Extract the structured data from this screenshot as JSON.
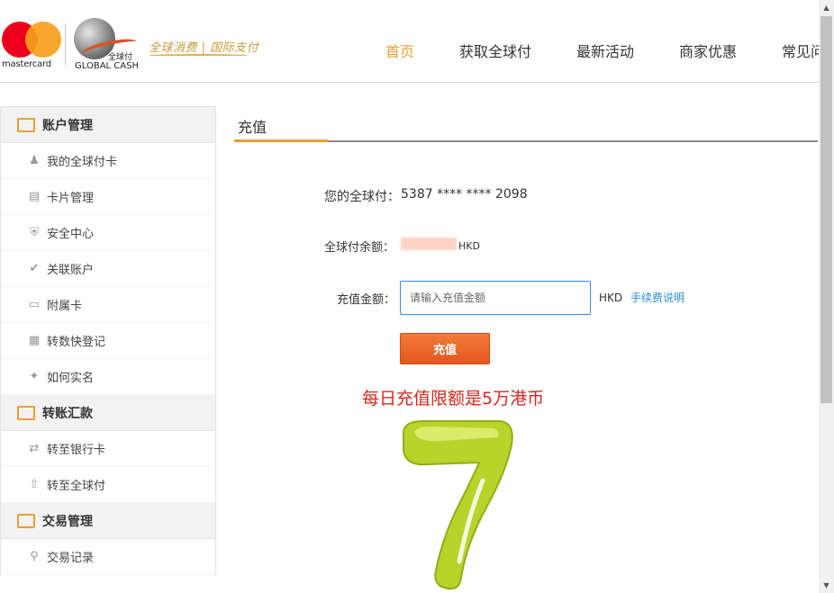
{
  "header": {
    "mastercard_text": "mastercard",
    "globalcash_cn": "全球付",
    "globalcash_en": "GLOBAL CASH",
    "slogan": "全球消费 | 国际支付",
    "nav": [
      {
        "label": "首页",
        "active": true
      },
      {
        "label": "获取全球付",
        "active": false
      },
      {
        "label": "最新活动",
        "active": false
      },
      {
        "label": "商家优惠",
        "active": false
      },
      {
        "label": "常见问",
        "active": false
      }
    ]
  },
  "sidebar": {
    "groups": [
      {
        "label": "账户管理",
        "items": [
          {
            "label": "我的全球付卡",
            "icon": "user-icon"
          },
          {
            "label": "卡片管理",
            "icon": "card-icon"
          },
          {
            "label": "安全中心",
            "icon": "shield-icon"
          },
          {
            "label": "关联账户",
            "icon": "check-circle-icon"
          },
          {
            "label": "附属卡",
            "icon": "card-outline-icon"
          },
          {
            "label": "转数快登记",
            "icon": "document-icon"
          },
          {
            "label": "如何实名",
            "icon": "badge-icon"
          }
        ]
      },
      {
        "label": "转账汇款",
        "items": [
          {
            "label": "转至银行卡",
            "icon": "exchange-icon"
          },
          {
            "label": "转至全球付",
            "icon": "upload-icon"
          }
        ]
      },
      {
        "label": "交易管理",
        "items": [
          {
            "label": "交易记录",
            "icon": "search-icon"
          }
        ]
      }
    ]
  },
  "main": {
    "tab_title": "充值",
    "card_label": "您的全球付：",
    "card_number": "5387 **** **** 2098",
    "balance_label": "全球付余额：",
    "balance_currency": "HKD",
    "amount_label": "充值金额：",
    "amount_placeholder": "请输入充值金额",
    "amount_currency": "HKD",
    "fee_link": "手续费说明",
    "submit_label": "充值",
    "limit_note": "每日充值限额是5万港币"
  },
  "colors": {
    "accent": "#e8a035",
    "button": "#e4561d",
    "link": "#2a8fd0",
    "note": "#d9261c",
    "seven": "#b8d42a"
  }
}
